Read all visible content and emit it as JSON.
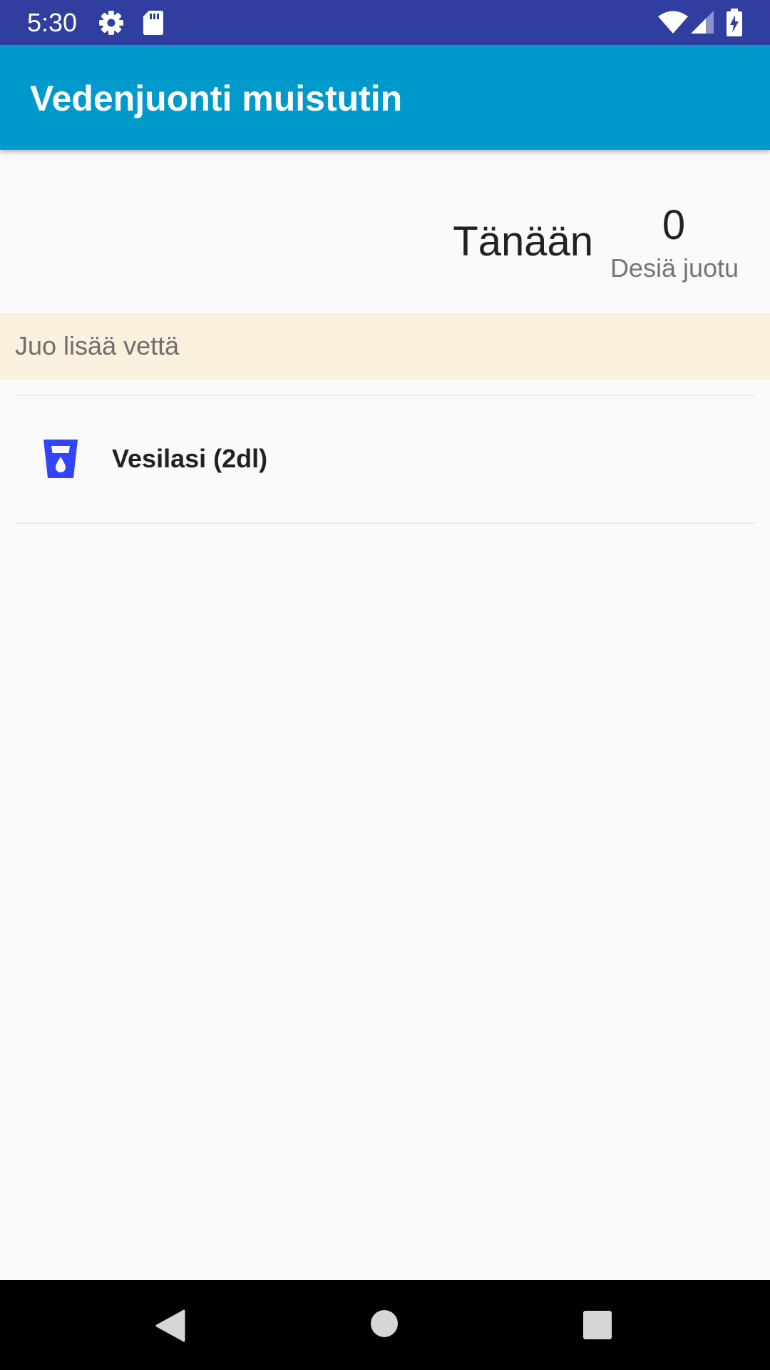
{
  "status_bar": {
    "time": "5:30",
    "icons": [
      "settings-icon",
      "sd-card-icon",
      "wifi-icon",
      "signal-icon",
      "battery-charging-icon"
    ]
  },
  "app_bar": {
    "title": "Vedenjuonti muistutin"
  },
  "summary": {
    "label": "Tänään",
    "count": "0",
    "unit": "Desiä juotu"
  },
  "reminder": {
    "text": "Juo lisää vettä"
  },
  "drinks": [
    {
      "label": "Vesilasi (2dl)",
      "icon": "water-glass-icon"
    }
  ],
  "nav_bar": {
    "buttons": [
      "back-icon",
      "home-icon",
      "recents-icon"
    ]
  },
  "colors": {
    "status_bar": "#303f9f",
    "app_bar": "#0099cc",
    "banner": "#f9f0dd",
    "glass_icon": "#3344ff",
    "background": "#fafafa"
  }
}
